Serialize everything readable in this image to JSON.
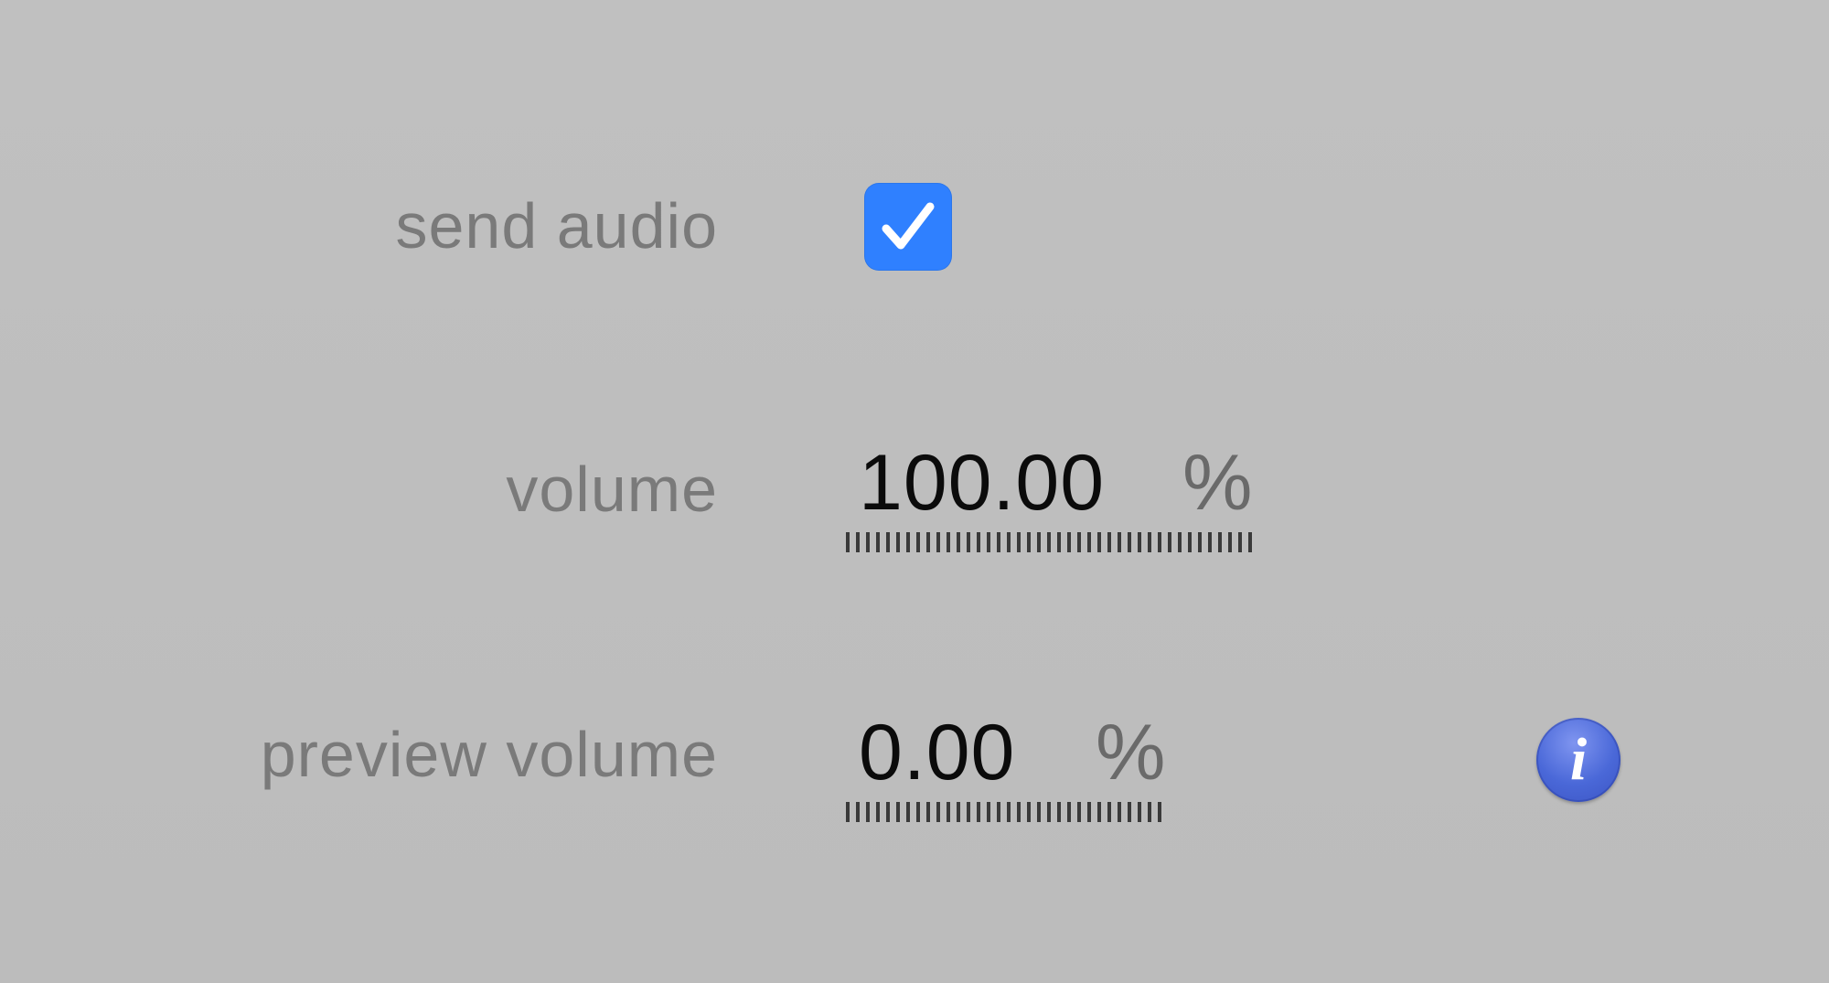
{
  "settings": {
    "send_audio": {
      "label": "send audio",
      "checked": true
    },
    "volume": {
      "label": "volume",
      "value": "100.00",
      "unit": "%"
    },
    "preview_volume": {
      "label": "preview volume",
      "value": "0.00",
      "unit": "%"
    },
    "info": {
      "icon": "info-icon",
      "glyph": "i"
    }
  },
  "colors": {
    "background": "#bdbdbd",
    "label_text": "#7a7a7a",
    "checkbox_accent": "#2f80ff",
    "info_accent": "#4a68d8"
  }
}
